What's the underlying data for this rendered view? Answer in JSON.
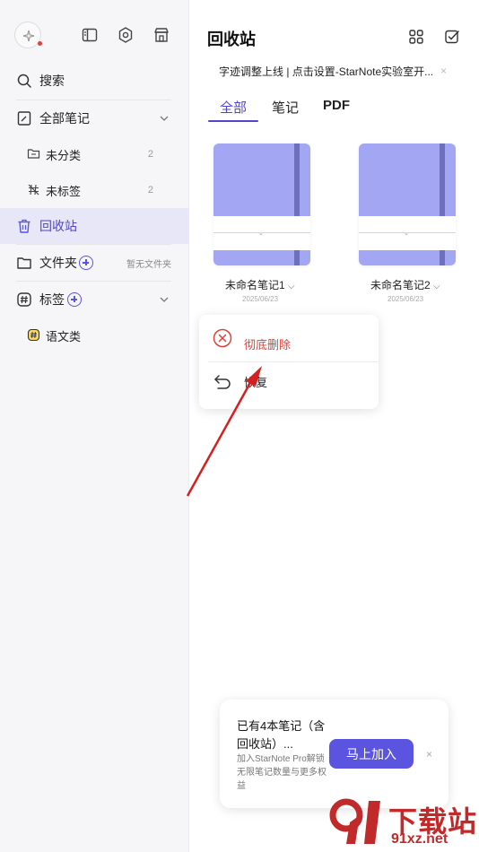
{
  "sidebar": {
    "search": "搜索",
    "all_notes": "全部笔记",
    "uncategorized": {
      "label": "未分类",
      "count": "2"
    },
    "untagged": {
      "label": "未标签",
      "count": "2"
    },
    "trash": "回收站",
    "folders": {
      "label": "文件夹",
      "hint": "暂无文件夹"
    },
    "tags": {
      "label": "标签",
      "items": [
        "语文类"
      ]
    }
  },
  "main": {
    "title": "回收站",
    "notice": "字迹调整上线 | 点击设置-StarNote实验室开...",
    "notice_close": "×",
    "tabs": [
      "全部",
      "笔记",
      "PDF"
    ],
    "notebooks": [
      {
        "name": "未命名笔记1",
        "date": "2025/06/23"
      },
      {
        "name": "未命名笔记2",
        "date": "2025/06/23"
      }
    ],
    "context_menu": {
      "delete": "彻底删除",
      "restore": "恢复"
    }
  },
  "promo": {
    "title": "已有4本笔记（含回收站）...",
    "desc": "加入StarNote Pro解锁无限笔记数量与更多权益",
    "button": "马上加入",
    "close": "×"
  },
  "watermark": {
    "line1": "下载站",
    "line2": "91xz.net"
  },
  "colors": {
    "accent": "#5b54e0",
    "danger": "#e0403a",
    "notebook_cover": "#a3a6f2",
    "arrow": "#d42020"
  }
}
